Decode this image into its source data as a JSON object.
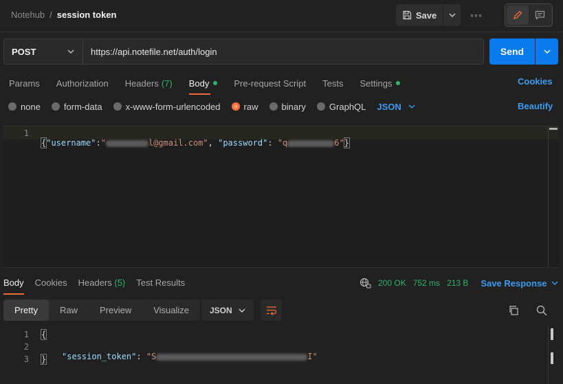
{
  "header": {
    "workspace": "Notehub",
    "separator": "/",
    "request_name": "session token",
    "save_label": "Save",
    "more_label": "◦◦◦"
  },
  "request": {
    "method": "POST",
    "url": "https://api.notefile.net/auth/login",
    "send_label": "Send"
  },
  "tabs": {
    "params": "Params",
    "authorization": "Authorization",
    "headers": "Headers",
    "headers_count": "(7)",
    "body": "Body",
    "prerequest": "Pre-request Script",
    "tests": "Tests",
    "settings": "Settings",
    "cookies": "Cookies"
  },
  "body_types": {
    "none": "none",
    "form_data": "form-data",
    "urlencoded": "x-www-form-urlencoded",
    "raw": "raw",
    "binary": "binary",
    "graphql": "GraphQL",
    "format": "JSON",
    "beautify": "Beautify"
  },
  "editor": {
    "line_no": "1",
    "open_brace": "{",
    "key_username": "\"username\"",
    "colon": ":",
    "username_prefix": "\"",
    "username_suffix": "l@gmail.com\"",
    "comma_sep": ", ",
    "key_password": "\"password\"",
    "colon_space": ": ",
    "password_prefix": "\"q",
    "password_suffix": "6\"",
    "close_brace": "}"
  },
  "response": {
    "tabs": {
      "body": "Body",
      "cookies": "Cookies",
      "headers": "Headers",
      "headers_count": "(5)",
      "test_results": "Test Results"
    },
    "status": "200 OK",
    "time": "752 ms",
    "size": "213 B",
    "save_response": "Save Response",
    "views": {
      "pretty": "Pretty",
      "raw": "Raw",
      "preview": "Preview",
      "visualize": "Visualize"
    },
    "format": "JSON",
    "lines": [
      "1",
      "2",
      "3"
    ],
    "open_brace": "{",
    "key": "\"session_token\"",
    "colon": ": ",
    "value_prefix": "\"S",
    "value_suffix": "I\"",
    "close_brace": "}"
  },
  "colors": {
    "accent_blue": "#097bed",
    "link_blue": "#3b9cf0",
    "active_orange": "#f26b3a",
    "success_green": "#2fb36a"
  }
}
